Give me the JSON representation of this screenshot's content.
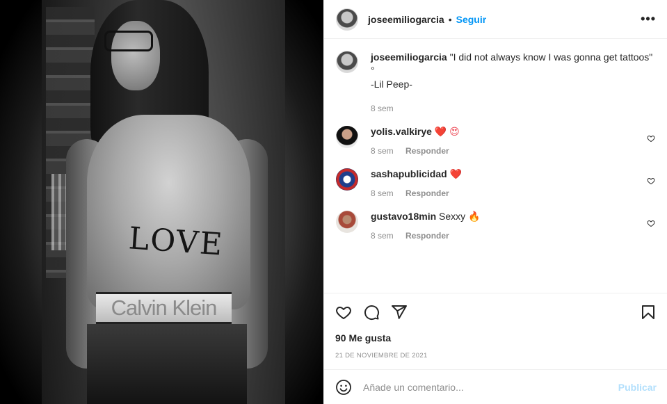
{
  "post": {
    "image_alt": "Fotografía en blanco y negro de un hombre de pelo largo con tatuajes y la palabra LOVE en el abdomen",
    "waistband_text": "Calvin Klein",
    "tattoo_text": "LOVE"
  },
  "header": {
    "username": "joseemiliogarcia",
    "separator": "•",
    "follow_label": "Seguir",
    "more_label": "•••"
  },
  "caption": {
    "username": "joseemiliogarcia",
    "text": "\"I did not always know I was gonna get tattoos\"",
    "line2": "°",
    "line3": "-Lil Peep-",
    "time": "8 sem"
  },
  "comments": [
    {
      "username": "yolis.valkirye",
      "text": "❤️ 😍",
      "time": "8 sem",
      "reply": "Responder"
    },
    {
      "username": "sashapublicidad",
      "text": "❤️",
      "time": "8 sem",
      "reply": "Responder"
    },
    {
      "username": "gustavo18min",
      "text": "Sexxy 🔥",
      "time": "8 sem",
      "reply": "Responder"
    }
  ],
  "likes": "90 Me gusta",
  "date": "21 DE NOVIEMBRE DE 2021",
  "add_comment": {
    "placeholder": "Añade un comentario...",
    "publish_label": "Publicar"
  }
}
